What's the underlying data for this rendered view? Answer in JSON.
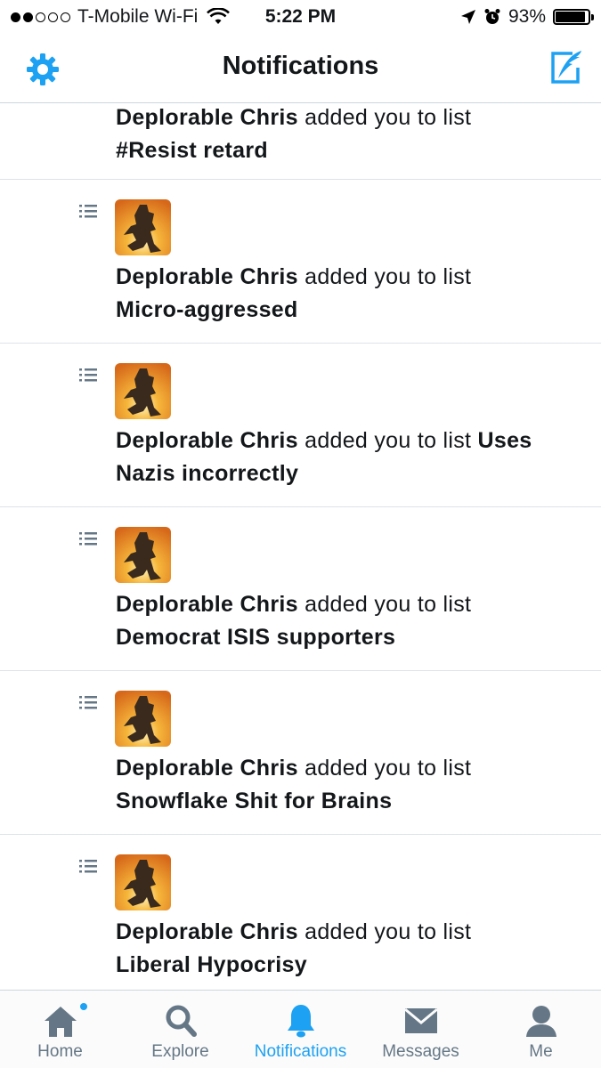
{
  "status_bar": {
    "carrier": "T-Mobile Wi-Fi",
    "time": "5:22 PM",
    "battery": "93%",
    "battery_level": 0.93,
    "signal_icon": "signal-dots-icon",
    "wifi_icon": "wifi-icon",
    "location_icon": "location-arrow-icon",
    "alarm_icon": "alarm-icon"
  },
  "header": {
    "title": "Notifications",
    "settings_icon": "gear-icon",
    "compose_icon": "compose-tweet-icon"
  },
  "notifications": [
    {
      "actor": "Deplorable Chris",
      "action": "added you to list",
      "list": "#Resist retard"
    },
    {
      "actor": "Deplorable Chris",
      "action": "added you to list",
      "list": "Micro-aggressed"
    },
    {
      "actor": "Deplorable Chris",
      "action": "added you to list",
      "list": "Uses Nazis incorrectly"
    },
    {
      "actor": "Deplorable Chris",
      "action": "added you to list",
      "list": "Democrat ISIS supporters"
    },
    {
      "actor": "Deplorable Chris",
      "action": "added you to list",
      "list": "Snowflake Shit for Brains"
    },
    {
      "actor": "Deplorable Chris",
      "action": "added you to list",
      "list": "Liberal Hypocrisy"
    }
  ],
  "tabs": [
    {
      "label": "Home",
      "icon": "home-icon",
      "active": false
    },
    {
      "label": "Explore",
      "icon": "search-icon",
      "active": false
    },
    {
      "label": "Notifications",
      "icon": "bell-icon",
      "active": true
    },
    {
      "label": "Messages",
      "icon": "envelope-icon",
      "active": false
    },
    {
      "label": "Me",
      "icon": "person-icon",
      "active": false
    }
  ],
  "colors": {
    "accent": "#1da1f2",
    "inactive": "#657786",
    "text": "#14171a"
  }
}
